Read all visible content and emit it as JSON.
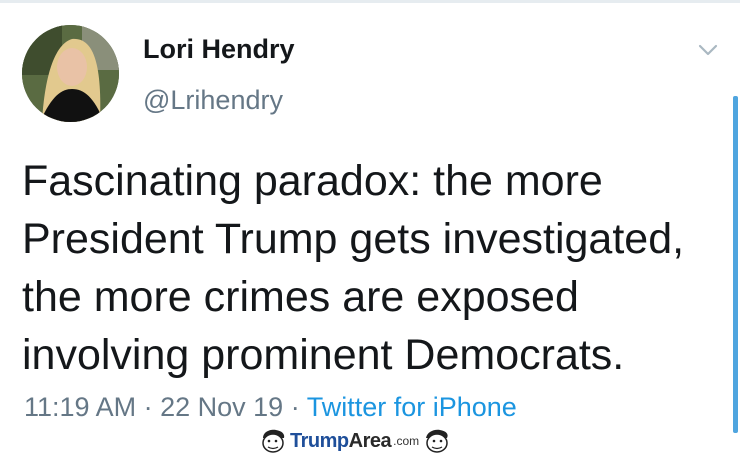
{
  "user": {
    "name": "Lori Hendry",
    "handle": "@Lrihendry"
  },
  "tweet": {
    "lines": [
      "Fascinating paradox: the more",
      "President Trump gets investigated,",
      "the more crimes are exposed",
      "involving prominent Democrats."
    ]
  },
  "meta": {
    "time": "11:19 AM",
    "separator": "·",
    "date": "22 Nov 19",
    "source": "Twitter for iPhone"
  },
  "watermark": {
    "brand_a": "Trump",
    "brand_b": "Area",
    "suffix": ".com"
  },
  "icons": {
    "menu": "chevron-down-icon",
    "watermark_face": "cartoon-face-icon"
  },
  "colors": {
    "text": "#14171a",
    "secondary": "#657786",
    "link": "#1b95e0",
    "scrollbar": "#4fa5df"
  }
}
